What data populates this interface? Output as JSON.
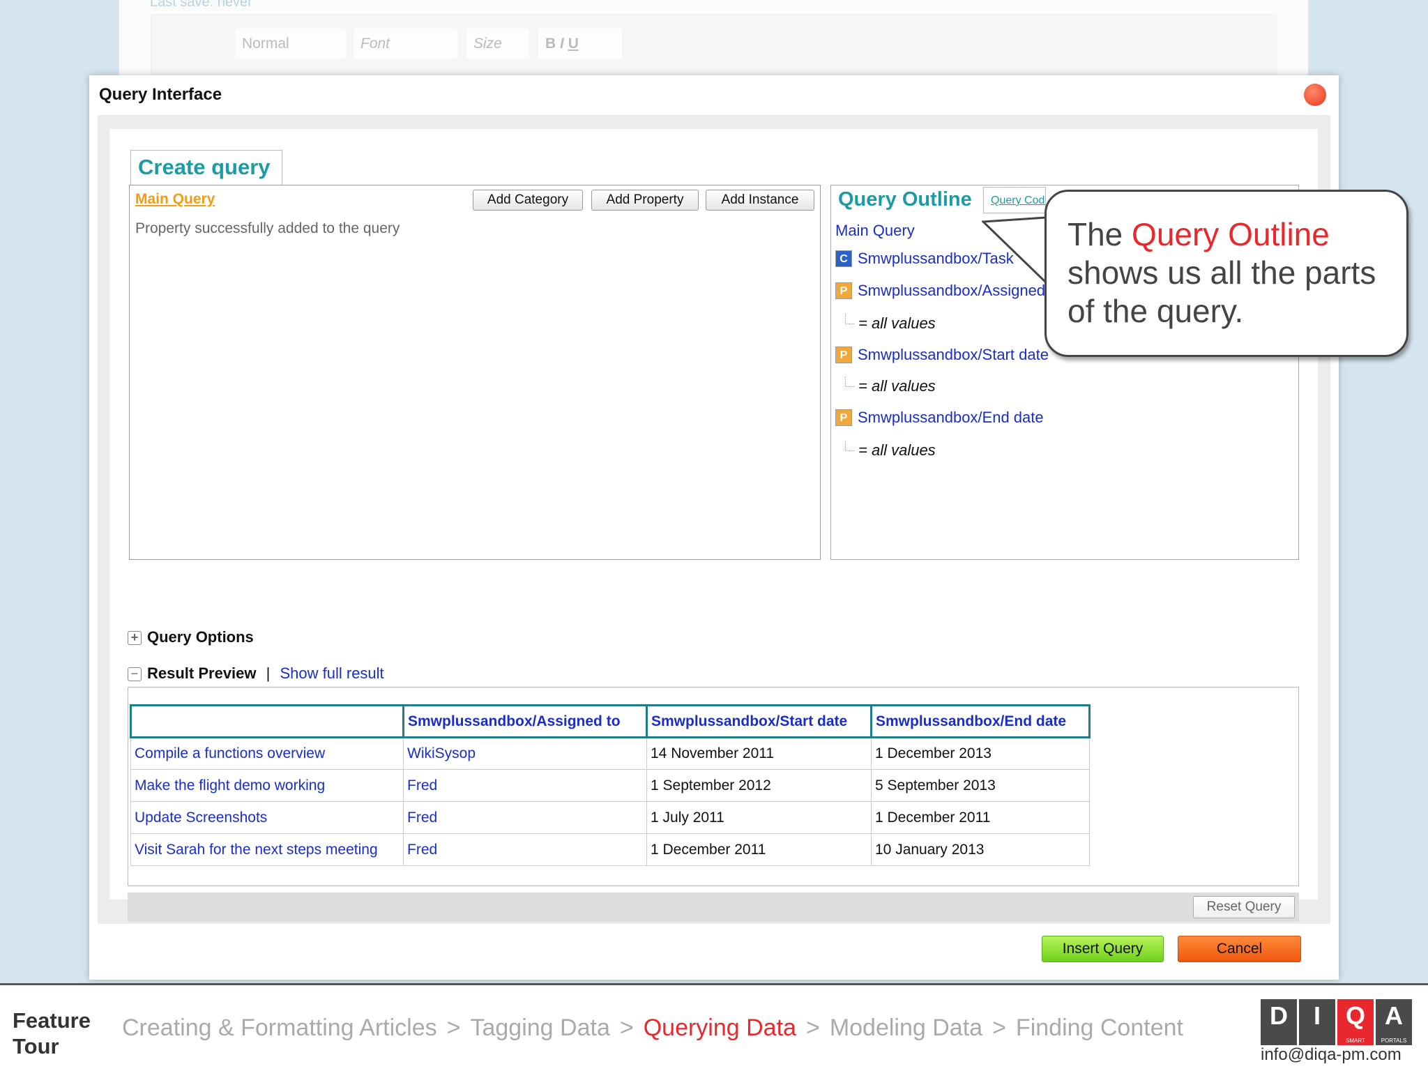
{
  "editor": {
    "last_save": "Last save: never",
    "format": "Normal",
    "font": "Font",
    "size": "Size"
  },
  "dialog": {
    "title": "Query Interface",
    "tab_create": "Create query",
    "main_query": "Main Query",
    "buttons": {
      "add_category": "Add Category",
      "add_property": "Add Property",
      "add_instance": "Add Instance"
    },
    "message": "Property successfully added to the query",
    "outline": {
      "tab": "Query Outline",
      "tab2": "Query Code",
      "root": "Main Query",
      "items": [
        {
          "type": "C",
          "label": "Smwplussandbox/Task"
        },
        {
          "type": "P",
          "label": "Smwplussandbox/Assigned to",
          "value": "= all values"
        },
        {
          "type": "P",
          "label": "Smwplussandbox/Start date",
          "value": "= all values"
        },
        {
          "type": "P",
          "label": "Smwplussandbox/End date",
          "value": "= all values"
        }
      ]
    },
    "query_options": "Query Options",
    "result_preview": "Result Preview",
    "separator": "|",
    "show_full": "Show full result",
    "table": {
      "headers": [
        "",
        "Smwplussandbox/Assigned to",
        "Smwplussandbox/Start date",
        "Smwplussandbox/End date"
      ],
      "rows": [
        [
          "Compile a functions overview",
          "WikiSysop",
          "14 November 2011",
          "1 December 2013"
        ],
        [
          "Make the flight demo working",
          "Fred",
          "1 September 2012",
          "5 September 2013"
        ],
        [
          "Update Screenshots",
          "Fred",
          "1 July 2011",
          "1 December 2011"
        ],
        [
          "Visit Sarah for the next steps meeting",
          "Fred",
          "1 December 2011",
          "10 January 2013"
        ]
      ]
    },
    "reset": "Reset Query",
    "insert": "Insert Query",
    "cancel": "Cancel"
  },
  "callout": {
    "pre": "The ",
    "highlight": "Query Outline",
    "post": " shows us all the parts of the query."
  },
  "footer": {
    "title": "Feature Tour",
    "crumbs": [
      "Creating & Formatting Articles",
      "Tagging Data",
      "Querying Data",
      "Modeling Data",
      "Finding Content"
    ],
    "sep": ">",
    "current_index": 2,
    "logo": {
      "letters": [
        "D",
        "I",
        "Q",
        "A"
      ],
      "sub": [
        "",
        "",
        "SMART",
        "PORTALS"
      ]
    },
    "email": "info@diqa-pm.com"
  },
  "colors": {
    "accent": "#1e9ba2",
    "link": "#1a2dc8",
    "highlight": "#e8282d"
  }
}
